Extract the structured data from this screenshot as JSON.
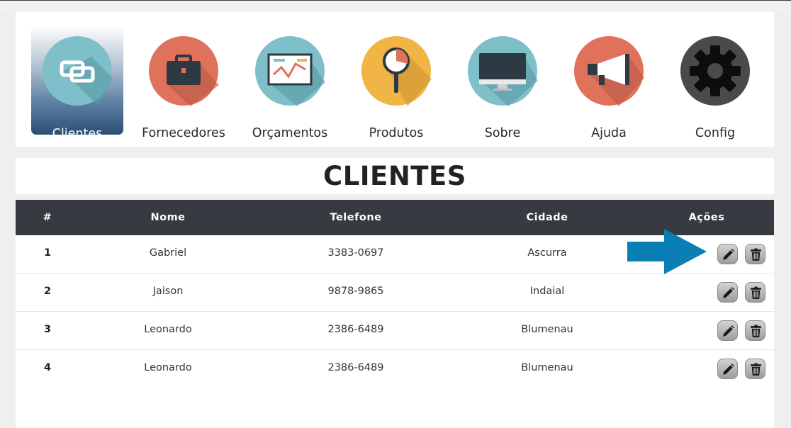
{
  "nav": {
    "items": [
      {
        "label": "Clientes",
        "color": "#7ebfc9",
        "icon": "link-icon"
      },
      {
        "label": "Fornecedores",
        "color": "#e0715a",
        "icon": "briefcase-icon"
      },
      {
        "label": "Orçamentos",
        "color": "#7ebfc9",
        "icon": "chart-board-icon"
      },
      {
        "label": "Produtos",
        "color": "#f0b545",
        "icon": "magnifier-icon"
      },
      {
        "label": "Sobre",
        "color": "#7ebfc9",
        "icon": "monitor-icon"
      },
      {
        "label": "Ajuda",
        "color": "#e0715a",
        "icon": "megaphone-icon"
      },
      {
        "label": "Config",
        "color": "#4a4a4a",
        "icon": "gear-icon"
      }
    ],
    "active": "Clientes"
  },
  "page": {
    "title": "CLIENTES"
  },
  "table": {
    "headers": {
      "num": "#",
      "nome": "Nome",
      "telefone": "Telefone",
      "cidade": "Cidade",
      "acoes": "Ações"
    },
    "rows": [
      {
        "num": "1",
        "nome": "Gabriel",
        "telefone": "3383-0697",
        "cidade": "Ascurra"
      },
      {
        "num": "2",
        "nome": "Jaison",
        "telefone": "9878-9865",
        "cidade": "Indaial"
      },
      {
        "num": "3",
        "nome": "Leonardo",
        "telefone": "2386-6489",
        "cidade": "Blumenau"
      },
      {
        "num": "4",
        "nome": "Leonardo",
        "telefone": "2386-6489",
        "cidade": "Blumenau"
      }
    ]
  },
  "annotation": {
    "arrow_color": "#0a7fb5",
    "icon": "arrow-right-icon"
  }
}
